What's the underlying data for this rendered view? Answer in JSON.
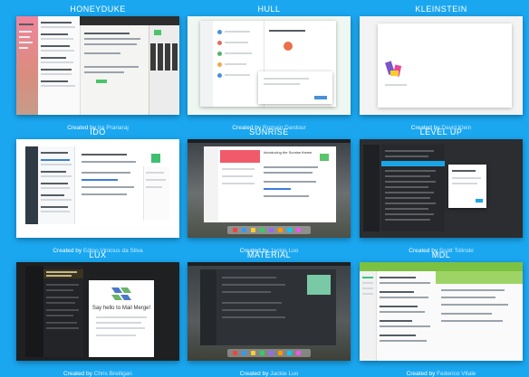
{
  "themes": [
    {
      "title": "HONEYDUKE",
      "credit_prefix": "Created by",
      "author": "Ira Pranaraj"
    },
    {
      "title": "HULL",
      "credit_prefix": "Created by",
      "author": "Romain Dardour"
    },
    {
      "title": "KLEINSTEIN",
      "credit_prefix": "Created by",
      "author": "David Klein"
    },
    {
      "title": "IDO",
      "credit_prefix": "Created by",
      "author": "Edipo Vinicius da Silva"
    },
    {
      "title": "SUNRISE",
      "credit_prefix": "Created by",
      "author": "Jackie Luo"
    },
    {
      "title": "LEVEL UP",
      "credit_prefix": "Created by",
      "author": "Scott Tolinski"
    },
    {
      "title": "LUX",
      "credit_prefix": "Created by",
      "author": "Chris Breiligan"
    },
    {
      "title": "MATERIAL",
      "credit_prefix": "Created by",
      "author": "Jackie Luo"
    },
    {
      "title": "MDL",
      "credit_prefix": "Created by",
      "author": "Federico Vitale"
    }
  ],
  "previews": {
    "lux": {
      "heading": "Say hello to Mail Merge!"
    },
    "sunrise": {
      "heading": "Introducing the Sunrise theme"
    }
  },
  "colors": {
    "background": "#1aa7f0",
    "honeyduke_sidebar": "#e7789a",
    "sunrise_banner": "#f05a6a",
    "level_up_highlight": "#1aa5e6",
    "lux_accent": "#4a78c8",
    "mdl_green": "#7cc242"
  }
}
